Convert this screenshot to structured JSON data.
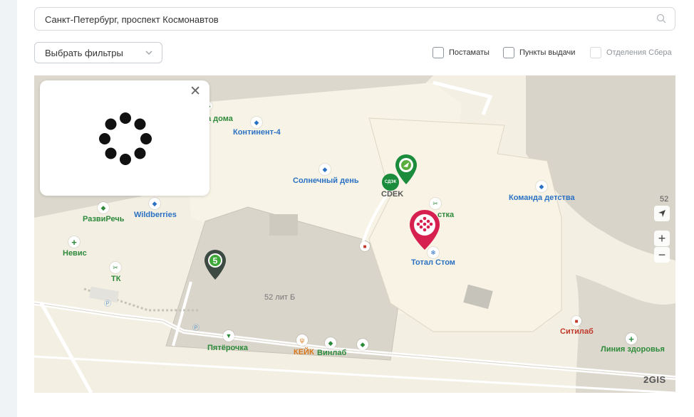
{
  "search": {
    "value": "Санкт-Петербург, проспект Космонавтов"
  },
  "filters": {
    "select_label": "Выбрать фильтры",
    "checkboxes": [
      {
        "label": "Постаматы",
        "checked": false,
        "disabled": false
      },
      {
        "label": "Пункты выдачи",
        "checked": false,
        "disabled": false
      },
      {
        "label": "Отделения Сбера",
        "checked": false,
        "disabled": true
      }
    ]
  },
  "popup": {
    "close_symbol": "✕",
    "state": "loading"
  },
  "map": {
    "labels": {
      "doma": "а дома",
      "kontinent": "Континент-4",
      "solnechny": "Солнечный день",
      "cdek": "CDEK",
      "cdek_badge": "СДЭК",
      "komanda": "Команда детства",
      "razvirech": "РазвиРечь",
      "wildberries": "Wildberries",
      "nevis": "Невис",
      "tk": "ТК",
      "stka": "стка",
      "total": "Тотал Стом",
      "lit": "52 лит Б",
      "pyaterochka": "Пятёрочка",
      "keik": "КЕЙК",
      "vinlab": "Винлаб",
      "sitilab": "Ситилаб",
      "liniya": "Линия здоровья",
      "pin_five": "5"
    },
    "zoom_level": "52",
    "zoom_in": "+",
    "zoom_out": "−",
    "logo": "2GIS",
    "colors": {
      "cdek_pin": "#1a8c3c",
      "selected_pin": "#d6204f",
      "five_pin": "#3d4a43",
      "poi_blue": "#2b71c3",
      "poi_green": "#2e8a3b"
    }
  }
}
